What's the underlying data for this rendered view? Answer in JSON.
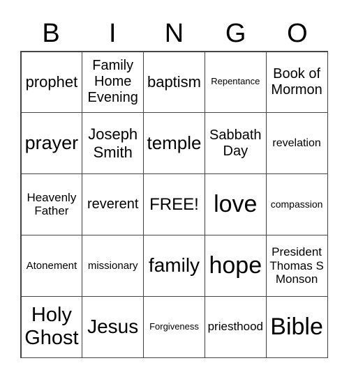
{
  "header": [
    "B",
    "I",
    "N",
    "G",
    "O"
  ],
  "cells": [
    "prophet",
    "Family\nHome\nEvening",
    "baptism",
    "Repentance",
    "Book of\nMormon",
    "prayer",
    "Joseph\nSmith",
    "temple",
    "Sabbath\nDay",
    "revelation",
    "Heavenly\nFather",
    "reverent",
    "FREE!",
    "love",
    "compassion",
    "Atonement",
    "missionary",
    "family",
    "hope",
    "President\nThomas S\nMonson",
    "Holy\nGhost",
    "Jesus",
    "Forgiveness",
    "priesthood",
    "Bible"
  ]
}
